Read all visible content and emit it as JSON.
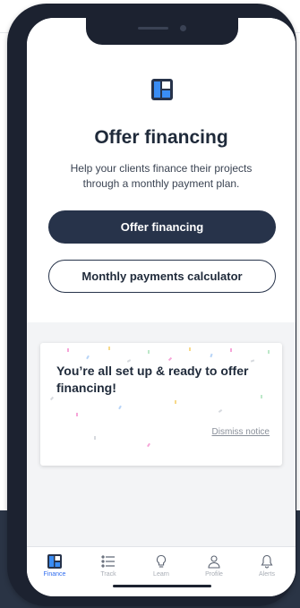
{
  "header": {
    "title": "Offer financing",
    "subtitle": "Help your clients finance their projects through a monthly payment plan."
  },
  "actions": {
    "primary_label": "Offer financing",
    "secondary_label": "Monthly payments calculator"
  },
  "notice": {
    "message": "You’re all set up & ready to offer financing!",
    "dismiss_label": "Dismiss notice"
  },
  "tabbar": {
    "active_tab": "Finance",
    "tabs": [
      {
        "label": "Finance",
        "icon": "grid-logo-icon"
      },
      {
        "label": "Track",
        "icon": "list-icon"
      },
      {
        "label": "Learn",
        "icon": "lightbulb-icon"
      },
      {
        "label": "Profile",
        "icon": "person-icon"
      },
      {
        "label": "Alerts",
        "icon": "bell-icon"
      }
    ]
  },
  "colors": {
    "primary": "#27334a",
    "accent": "#2f6df0",
    "text": "#1f2a3a",
    "muted": "#a8adb5"
  }
}
